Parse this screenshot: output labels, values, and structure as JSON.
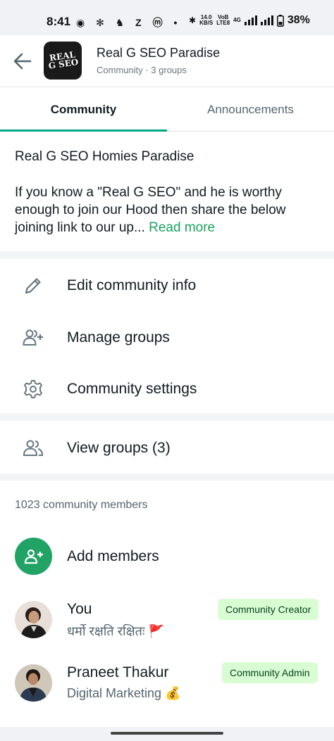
{
  "status": {
    "time": "8:41",
    "left_icons": "◉ ✻ ♞ Z ⓜ •",
    "net_speed_top": "14.0",
    "net_speed_bottom": "KB/S",
    "volte_top": "VoB",
    "volte_bottom": "LTE8",
    "signal_label": "4G",
    "battery": "38%"
  },
  "header": {
    "title": "Real G SEO Paradise",
    "subtitle": "Community · 3 groups",
    "avatar_text_1": "REAL",
    "avatar_text_2": "G SEO"
  },
  "tabs": {
    "community": "Community",
    "announcements": "Announcements"
  },
  "description": {
    "name": "Real G SEO Homies Paradise",
    "text": "If you know a \"Real G SEO\" and he is worthy enough to join our Hood then share the below joining link to our up...",
    "read_more": "Read more"
  },
  "menu": {
    "edit_info": "Edit community info",
    "manage_groups": "Manage groups",
    "settings": "Community settings",
    "view_groups": "View groups (3)"
  },
  "members": {
    "count_label": "1023 community members",
    "add_label": "Add members",
    "list": [
      {
        "name": "You",
        "about": "धर्मो रक्षति रक्षितः 🚩",
        "badge": "Community Creator"
      },
      {
        "name": "Praneet Thakur",
        "about": "Digital Marketing 💰",
        "badge": "Community Admin"
      }
    ]
  },
  "icons": {
    "back": "arrow-left-icon",
    "edit": "pencil-icon",
    "manage": "people-add-icon",
    "settings": "gear-icon",
    "groups": "people-icon",
    "add": "person-add-icon"
  },
  "colors": {
    "accent": "#00a884",
    "link": "#1da15f",
    "add_button": "#21a366",
    "badge_bg": "#d8fdd2"
  }
}
